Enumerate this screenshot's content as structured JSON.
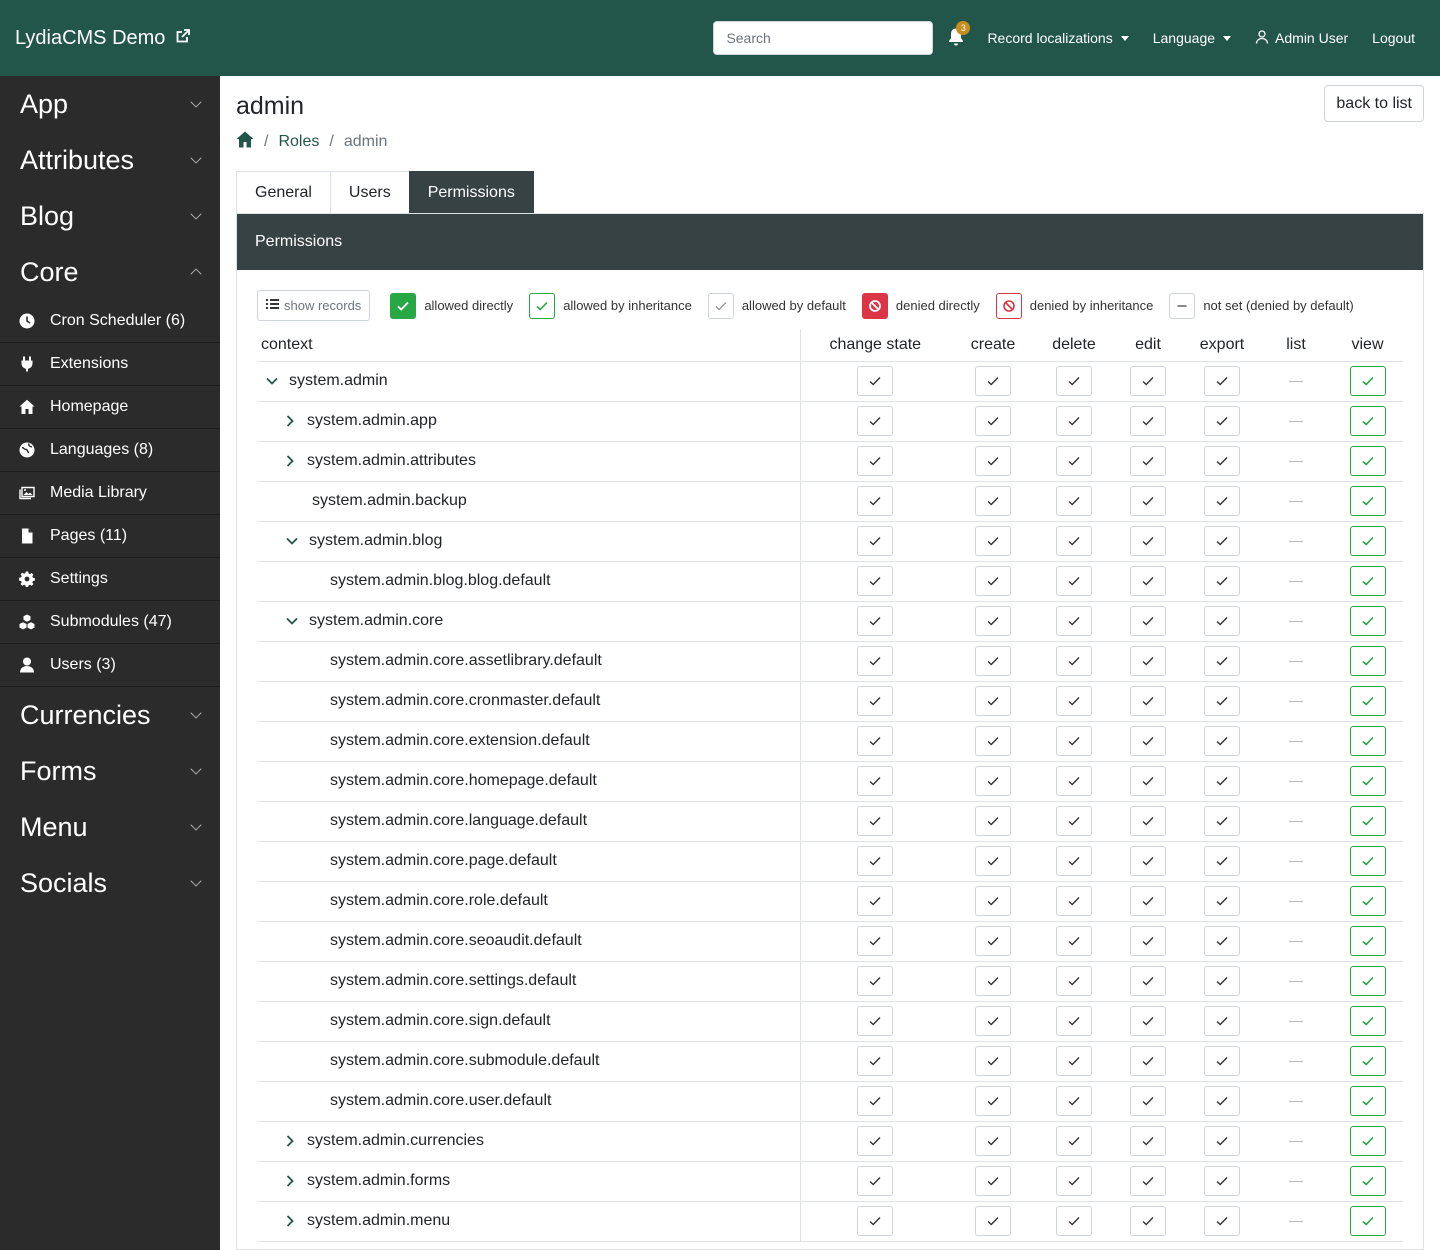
{
  "header": {
    "brand": "LydiaCMS Demo",
    "search_placeholder": "Search",
    "notification_count": "3",
    "record_localizations": "Record localizations",
    "language": "Language",
    "user": "Admin User",
    "logout": "Logout"
  },
  "sidebar": {
    "groups_top": [
      {
        "label": "App",
        "expanded": false
      },
      {
        "label": "Attributes",
        "expanded": false
      },
      {
        "label": "Blog",
        "expanded": false
      },
      {
        "label": "Core",
        "expanded": true
      }
    ],
    "core_items": [
      {
        "label": "Cron Scheduler (6)",
        "icon": "clock-icon"
      },
      {
        "label": "Extensions",
        "icon": "plug-icon"
      },
      {
        "label": "Homepage",
        "icon": "home-icon"
      },
      {
        "label": "Languages (8)",
        "icon": "globe-icon"
      },
      {
        "label": "Media Library",
        "icon": "images-icon"
      },
      {
        "label": "Pages (11)",
        "icon": "file-icon"
      },
      {
        "label": "Settings",
        "icon": "gear-icon"
      },
      {
        "label": "Submodules (47)",
        "icon": "cubes-icon"
      },
      {
        "label": "Users (3)",
        "icon": "user-icon"
      }
    ],
    "groups_bottom": [
      {
        "label": "Currencies",
        "expanded": false
      },
      {
        "label": "Forms",
        "expanded": false
      },
      {
        "label": "Menu",
        "expanded": false
      },
      {
        "label": "Socials",
        "expanded": false
      }
    ]
  },
  "page": {
    "title": "admin",
    "back_button": "back to list",
    "breadcrumb": {
      "roles": "Roles",
      "current": "admin"
    },
    "tabs": [
      {
        "label": "General",
        "active": false
      },
      {
        "label": "Users",
        "active": false
      },
      {
        "label": "Permissions",
        "active": true
      }
    ],
    "card_title": "Permissions"
  },
  "legend": {
    "show_records": "show records",
    "allowed_directly": "allowed directly",
    "allowed_by_inheritance": "allowed by inheritance",
    "allowed_by_default": "allowed by default",
    "denied_directly": "denied directly",
    "denied_by_inheritance": "denied by inheritance",
    "not_set": "not set (denied by default)"
  },
  "colors": {
    "header_bg": "#22564a",
    "sidebar_bg": "#2b2b2b",
    "card_header_bg": "#374244",
    "allowed_green": "#28a745",
    "denied_red": "#dc3545",
    "badge": "#c88b1c"
  },
  "table": {
    "columns": [
      "context",
      "change state",
      "create",
      "delete",
      "edit",
      "export",
      "list",
      "view"
    ],
    "rows": [
      {
        "context": "system.admin",
        "toggle": "down"
      },
      {
        "context": "system.admin.app",
        "toggle": "right"
      },
      {
        "context": "system.admin.attributes",
        "toggle": "right"
      },
      {
        "context": "system.admin.backup",
        "toggle": "none"
      },
      {
        "context": "system.admin.blog",
        "toggle": "down"
      },
      {
        "context": "system.admin.blog.blog.default",
        "toggle": "leaf"
      },
      {
        "context": "system.admin.core",
        "toggle": "down"
      },
      {
        "context": "system.admin.core.assetlibrary.default",
        "toggle": "leaf"
      },
      {
        "context": "system.admin.core.cronmaster.default",
        "toggle": "leaf"
      },
      {
        "context": "system.admin.core.extension.default",
        "toggle": "leaf"
      },
      {
        "context": "system.admin.core.homepage.default",
        "toggle": "leaf"
      },
      {
        "context": "system.admin.core.language.default",
        "toggle": "leaf"
      },
      {
        "context": "system.admin.core.page.default",
        "toggle": "leaf"
      },
      {
        "context": "system.admin.core.role.default",
        "toggle": "leaf"
      },
      {
        "context": "system.admin.core.seoaudit.default",
        "toggle": "leaf"
      },
      {
        "context": "system.admin.core.settings.default",
        "toggle": "leaf"
      },
      {
        "context": "system.admin.core.sign.default",
        "toggle": "leaf"
      },
      {
        "context": "system.admin.core.submodule.default",
        "toggle": "leaf"
      },
      {
        "context": "system.admin.core.user.default",
        "toggle": "leaf"
      },
      {
        "context": "system.admin.currencies",
        "toggle": "right"
      },
      {
        "context": "system.admin.forms",
        "toggle": "right"
      },
      {
        "context": "system.admin.menu",
        "toggle": "right"
      }
    ],
    "cell_states": {
      "change state": "allowed by default",
      "create": "allowed by default",
      "delete": "allowed by default",
      "edit": "allowed by default",
      "export": "allowed by default",
      "list": "not set",
      "view": "allowed by inheritance"
    }
  }
}
